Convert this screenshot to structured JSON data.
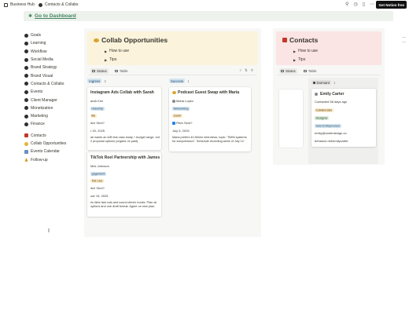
{
  "topbar": {
    "workspace": "Business Hub",
    "page": "Contacts & Collabs",
    "cta": "Get Notion free",
    "icons": [
      "search-icon",
      "history-icon",
      "share-icon",
      "duplicate-icon",
      "more-icon"
    ]
  },
  "dashboard_link": "Go to Dashboard",
  "nav": {
    "group1": [
      "Goals",
      "Learning",
      "Workflow",
      "Social Media",
      "Brand Strategy",
      "Brand Visual",
      "Contacts & Collabs",
      "Events",
      "Client Manager",
      "Monetization",
      "Marketing",
      "Finance"
    ],
    "group2": [
      "Contacts",
      "Collab Opportunities",
      "Events Calendar",
      "Follow-up"
    ]
  },
  "collab": {
    "title": "Collab Opportunities",
    "toggle1": "How to use",
    "toggle2": "Tips",
    "view_status": "Status",
    "view_table": "Table",
    "col1_label": "rogress",
    "col1_count": "2",
    "col2_label": "Success",
    "col2_count": "1",
    "card1": {
      "title": "Instagram Ads Collab with Sarah",
      "person": "arah Kim",
      "type": "rtnership",
      "tag": "ilie",
      "pitch": "itch Sent?",
      "date": "r 20, 2025",
      "notes": "ah wants an A/B test case study + budget range. ent 2 proposal options (organic vs paid)."
    },
    "card2": {
      "title": "TikTok Reel Partnership with James",
      "person": "Mes Johnson",
      "type": "gagement",
      "tag": "Tok Live",
      "pitch": "itch Sent?",
      "date": "uar 15, 2025",
      "notes": "es likes fast cuts and sound-driven hooks. Plan ok options and one draft format. Agree on new plan."
    },
    "card3": {
      "title": "Podcast Guest Swap with Maria",
      "person": "Maria Lopez",
      "type": "Networking",
      "tag": "Zoom",
      "pitch": "Pitch Sent?",
      "date": "July 5, 2025",
      "notes": "Maria prefers 40-60min interviews, topic: \"SMM systems for solopreneurs\". Schedule recording week of July 12."
    }
  },
  "contacts": {
    "title": "Contacts",
    "toggle1": "How to use",
    "toggle2": "Tips",
    "view_status": "Status",
    "view_table": "Table",
    "col_label": "Dormant",
    "col_count": "1",
    "card": {
      "name": "Emily Carter",
      "contacted": "Contacted 58 days ago",
      "tag1": "Collaborator",
      "tag2": "Designer",
      "tag3": "Solo Entrepreneur",
      "email": "emily@carterdesign.co",
      "site": "behance.net/emilycarter"
    }
  },
  "colors": {
    "dash_bg": "#edf3ec",
    "dash_text": "#448361",
    "collab_head": "#fbf3db",
    "contacts_head": "#fbe4e4",
    "panel_bg": "#f7f7f5"
  }
}
